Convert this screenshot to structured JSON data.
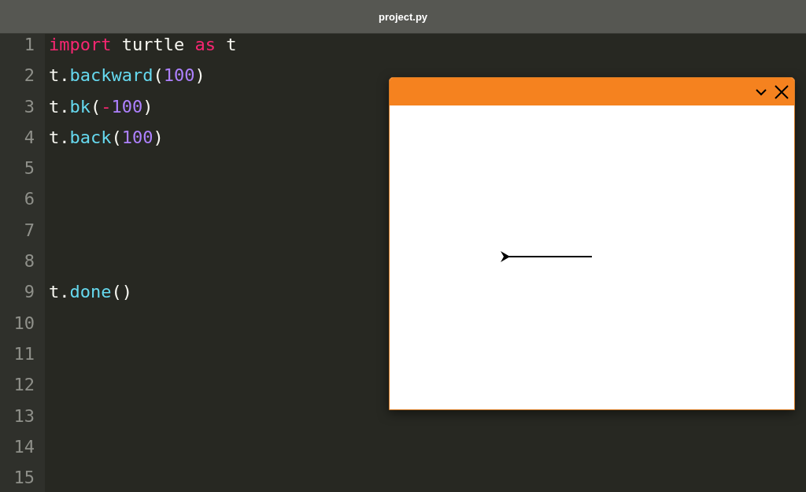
{
  "window": {
    "title": "project.py"
  },
  "editor": {
    "lines": [
      {
        "number": "1",
        "tokens": [
          {
            "text": "import",
            "kind": "keyword"
          },
          {
            "text": " turtle ",
            "kind": "plain"
          },
          {
            "text": "as",
            "kind": "keyword"
          },
          {
            "text": " t",
            "kind": "plain"
          }
        ]
      },
      {
        "number": "2",
        "tokens": [
          {
            "text": "t.",
            "kind": "plain"
          },
          {
            "text": "backward",
            "kind": "func"
          },
          {
            "text": "(",
            "kind": "plain"
          },
          {
            "text": "100",
            "kind": "number"
          },
          {
            "text": ")",
            "kind": "plain"
          }
        ]
      },
      {
        "number": "3",
        "tokens": [
          {
            "text": "t.",
            "kind": "plain"
          },
          {
            "text": "bk",
            "kind": "func"
          },
          {
            "text": "(",
            "kind": "plain"
          },
          {
            "text": "-",
            "kind": "keyword"
          },
          {
            "text": "100",
            "kind": "number"
          },
          {
            "text": ")",
            "kind": "plain"
          }
        ]
      },
      {
        "number": "4",
        "tokens": [
          {
            "text": "t.",
            "kind": "plain"
          },
          {
            "text": "back",
            "kind": "func"
          },
          {
            "text": "(",
            "kind": "plain"
          },
          {
            "text": "100",
            "kind": "number"
          },
          {
            "text": ")",
            "kind": "plain"
          }
        ]
      },
      {
        "number": "5"
      },
      {
        "number": "6"
      },
      {
        "number": "7"
      },
      {
        "number": "8"
      },
      {
        "number": "9",
        "tokens": [
          {
            "text": "t.",
            "kind": "plain"
          },
          {
            "text": "done",
            "kind": "func"
          },
          {
            "text": "()",
            "kind": "plain"
          }
        ]
      },
      {
        "number": "10"
      },
      {
        "number": "11"
      },
      {
        "number": "12"
      },
      {
        "number": "13"
      },
      {
        "number": "14"
      },
      {
        "number": "15"
      }
    ]
  },
  "turtle_window": {
    "expanded": true
  }
}
